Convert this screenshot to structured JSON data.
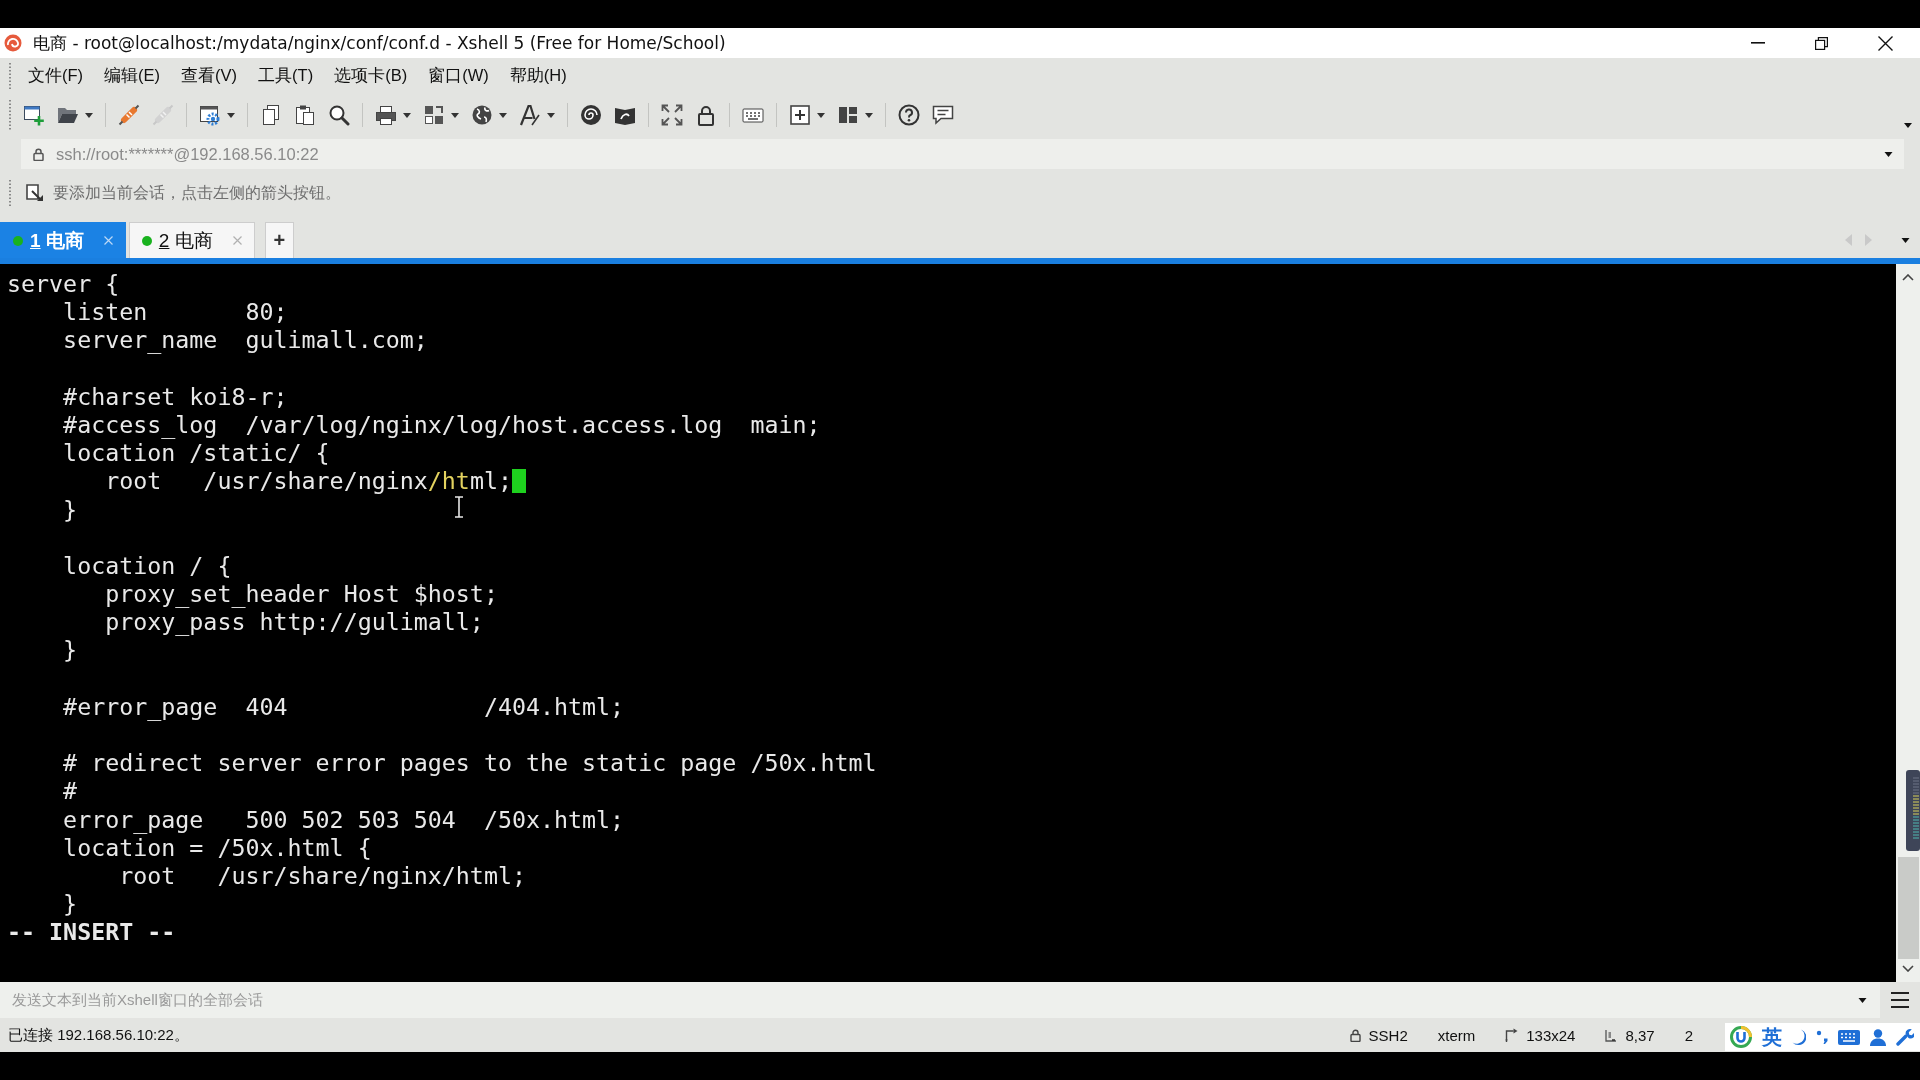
{
  "window": {
    "title": "电商 - root@localhost:/mydata/nginx/conf/conf.d - Xshell 5 (Free for Home/School)"
  },
  "menu": [
    "文件(F)",
    "编辑(E)",
    "查看(V)",
    "工具(T)",
    "选项卡(B)",
    "窗口(W)",
    "帮助(H)"
  ],
  "address_bar": {
    "value": "ssh://root:*******@192.168.56.10:22"
  },
  "hint_bar": {
    "text": "要添加当前会话，点击左侧的箭头按钮。"
  },
  "tabs": [
    {
      "number": "1",
      "label": "电商",
      "selected": true,
      "connected": true
    },
    {
      "number": "2",
      "label": "电商",
      "selected": false,
      "connected": true
    }
  ],
  "new_tab_button": "+",
  "terminal": {
    "lines": [
      {
        "kind": "code",
        "text": "server {",
        "cursor": false
      },
      {
        "kind": "code",
        "text": "    listen       80;",
        "cursor": false
      },
      {
        "kind": "code",
        "text": "    server_name  gulimall.com;",
        "cursor": false
      },
      {
        "kind": "blank",
        "cursor": false
      },
      {
        "kind": "code",
        "text": "    #charset koi8-r;",
        "cursor": false
      },
      {
        "kind": "code",
        "text": "    #access_log  /var/log/nginx/log/host.access.log  main;",
        "cursor": false
      },
      {
        "kind": "code",
        "text": "    location /static/ {",
        "cursor": false
      },
      {
        "kind": "code",
        "parts": [
          {
            "text": "       root   /usr/share/nginx",
            "highlight": false
          },
          {
            "text": "/ht",
            "highlight": true
          },
          {
            "text": "ml;",
            "highlight": false
          }
        ],
        "cursor": true
      },
      {
        "kind": "code",
        "text": "    }",
        "cursor": false
      },
      {
        "kind": "blank",
        "cursor": false
      },
      {
        "kind": "code",
        "text": "    location / {",
        "cursor": false
      },
      {
        "kind": "code",
        "text": "       proxy_set_header Host $host;",
        "cursor": false
      },
      {
        "kind": "code",
        "text": "       proxy_pass http://gulimall;",
        "cursor": false
      },
      {
        "kind": "code",
        "text": "    }",
        "cursor": false
      },
      {
        "kind": "blank",
        "cursor": false
      },
      {
        "kind": "code",
        "text": "    #error_page  404              /404.html;",
        "cursor": false
      },
      {
        "kind": "blank",
        "cursor": false
      },
      {
        "kind": "code",
        "text": "    # redirect server error pages to the static page /50x.html",
        "cursor": false
      },
      {
        "kind": "code",
        "text": "    #",
        "cursor": false
      },
      {
        "kind": "code",
        "text": "    error_page   500 502 503 504  /50x.html;",
        "cursor": false
      },
      {
        "kind": "code",
        "text": "    location = /50x.html {",
        "cursor": false
      },
      {
        "kind": "code",
        "text": "        root   /usr/share/nginx/html;",
        "cursor": false
      },
      {
        "kind": "code",
        "text": "    }",
        "cursor": false
      }
    ],
    "mode": "-- INSERT --"
  },
  "compose_bar": {
    "placeholder": "发送文本到当前Xshell窗口的全部会话"
  },
  "status_bar": {
    "connection": "已连接 192.168.56.10:22。",
    "items": [
      {
        "kind": "protocol",
        "text": "SSH2"
      },
      {
        "kind": "terminal",
        "text": "xterm"
      },
      {
        "kind": "size",
        "text": "133x24"
      },
      {
        "kind": "position",
        "text": "8,37"
      },
      {
        "kind": "plain",
        "text": "2"
      }
    ]
  },
  "ime_bar": {
    "language": "英"
  }
}
